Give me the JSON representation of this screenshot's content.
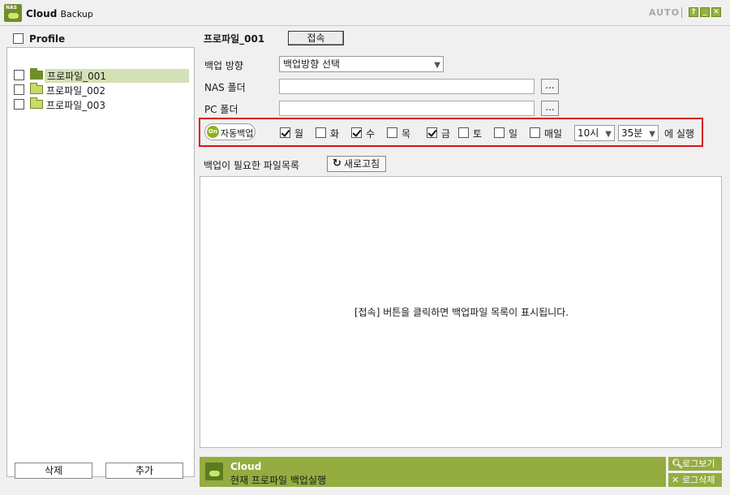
{
  "window": {
    "app_name": "Cloud",
    "app_name_sub": "Backup",
    "logo_text": "NAS",
    "auto_label": "AUTO",
    "controls": {
      "help": "?",
      "minimize": "_",
      "close": "✕"
    }
  },
  "left_panel": {
    "header": {
      "label": "Profile",
      "checked": false
    },
    "items": [
      {
        "label": "프로파일_001",
        "checked": false,
        "selected": true
      },
      {
        "label": "프로파일_002",
        "checked": false,
        "selected": false
      },
      {
        "label": "프로파일_003",
        "checked": false,
        "selected": false
      }
    ],
    "delete_label": "삭제",
    "add_label": "추가"
  },
  "main": {
    "profile_title": "프로파일_001",
    "connect_label": "접속",
    "direction": {
      "label": "백업 방향",
      "value": "백업방향 선택"
    },
    "nas_folder": {
      "label": "NAS 폴더",
      "value": "",
      "browse": "..."
    },
    "pc_folder": {
      "label": "PC 폴더",
      "value": "",
      "browse": "..."
    },
    "schedule": {
      "toggle_state": "On",
      "toggle_label": "자동백업",
      "days": [
        {
          "label": "월",
          "checked": true
        },
        {
          "label": "화",
          "checked": false
        },
        {
          "label": "수",
          "checked": true
        },
        {
          "label": "목",
          "checked": false
        },
        {
          "label": "금",
          "checked": true
        },
        {
          "label": "토",
          "checked": false
        },
        {
          "label": "일",
          "checked": false
        },
        {
          "label": "매일",
          "checked": false
        }
      ],
      "hour": "10시",
      "minute": "35분",
      "run_label": "에 실행"
    },
    "files": {
      "label": "백업이 필요한 파일목록",
      "refresh_label": "새로고침",
      "empty_message": "[접속] 버튼을 클릭하면 백업파일 목록이 표시됩니다."
    }
  },
  "status": {
    "title": "Cloud",
    "message": "현재 프로파일 백업실행",
    "log_view_label": "로그보기",
    "log_delete_label": "로그삭제"
  },
  "colors": {
    "accent_green": "#94ac40",
    "highlight_red": "#dd1111",
    "selection": "#d4e1b4"
  }
}
